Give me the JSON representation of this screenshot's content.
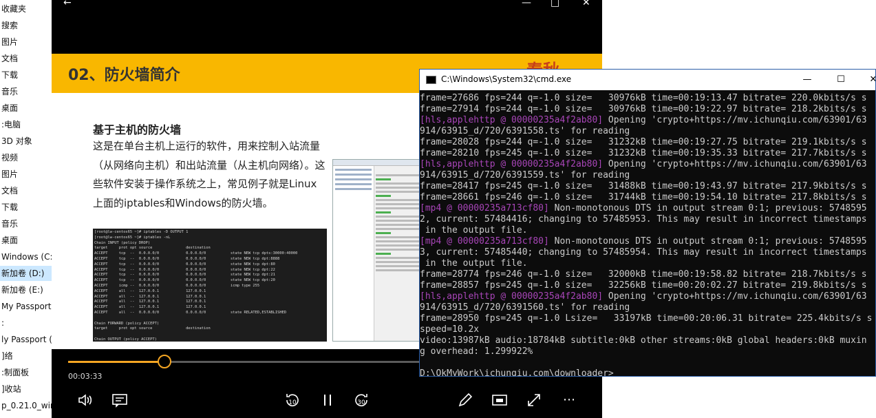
{
  "explorer": {
    "items": [
      {
        "label": "收藏夹"
      },
      {
        "label": "搜索"
      },
      {
        "label": "图片"
      },
      {
        "label": "文档"
      },
      {
        "label": "下载"
      },
      {
        "label": "音乐"
      },
      {
        "label": "桌面"
      },
      {
        "label": ":电脑"
      },
      {
        "label": "3D 对象"
      },
      {
        "label": "视频"
      },
      {
        "label": "图片"
      },
      {
        "label": "文档"
      },
      {
        "label": "下载"
      },
      {
        "label": "音乐"
      },
      {
        "label": "桌面"
      },
      {
        "label": "Windows (C:"
      },
      {
        "label": "新加卷 (D:)"
      },
      {
        "label": "新加卷 (E:)"
      },
      {
        "label": "My Passport"
      },
      {
        "label": ":"
      },
      {
        "label": "ly Passport ("
      },
      {
        "label": "]络"
      },
      {
        "label": ":制面板"
      },
      {
        "label": "]收站"
      },
      {
        "label": "p_0.21.0_win"
      }
    ],
    "selected_index": 16,
    "selected_color": "#cce8ff"
  },
  "player": {
    "slide": {
      "title": "02、防火墙简介",
      "logo_text": "春秋",
      "subtitle": "基于主机的防火墙",
      "paragraph": "这是在单台主机上运行的软件，用来控制入站流量（从网络向主机）和出站流量（从主机向网络）。这些软件安装于操作系统之上，常见例子就是Linux上面的iptables和Windows的防火墙。",
      "terminal_lines": [
        "[root@lw-centos65 ~]# iptables -D OUTPUT 1",
        "[root@lw-centos65 ~]# iptables -nL",
        "Chain INPUT (policy DROP)",
        "target     prot opt source               destination",
        "ACCEPT     tcp  --  0.0.0.0/0            0.0.0.0/0           state NEW tcp dpts:30000:40000",
        "ACCEPT     tcp  --  0.0.0.0/0            0.0.0.0/0           state NEW tcp dpt:8888",
        "ACCEPT     tcp  --  0.0.0.0/0            0.0.0.0/0           state NEW tcp dpt:80",
        "ACCEPT     tcp  --  0.0.0.0/0            0.0.0.0/0           state NEW tcp dpt:22",
        "ACCEPT     tcp  --  0.0.0.0/0            0.0.0.0/0           state NEW tcp dpt:21",
        "ACCEPT     tcp  --  0.0.0.0/0            0.0.0.0/0           state NEW tcp dpt:20",
        "ACCEPT     icmp --  0.0.0.0/0            0.0.0.0/0           icmp type 255",
        "ACCEPT     all  --  127.0.0.1            127.0.0.1",
        "ACCEPT     all  --  127.0.0.1            127.0.0.1",
        "ACCEPT     all  --  127.0.0.1            127.0.0.1",
        "ACCEPT     all  --  127.0.0.1            127.0.0.1",
        "ACCEPT     all  --  0.0.0.0/0            0.0.0.0/0           state RELATED,ESTABLISHED",
        "",
        "Chain FORWARD (policy ACCEPT)",
        "target     prot opt source               destination",
        "",
        "Chain OUTPUT (policy ACCEPT)"
      ]
    },
    "current_time": "00:03:33",
    "progress_fraction": 0.18,
    "accent_color": "#f5a623",
    "controls": {
      "back_icon": "arrow-left-icon",
      "minimize_icon": "minimize-icon",
      "maximize_icon": "maximize-icon",
      "close_icon": "close-icon",
      "rewind_label": "10",
      "forward_label": "30"
    }
  },
  "cmd": {
    "title": "C:\\Windows\\System32\\cmd.exe",
    "lines": [
      {
        "prefix": "",
        "text": "frame=27686 fps=244 q=-1.0 size=   30976kB time=00:19:13.47 bitrate= 220.0kbits/s s"
      },
      {
        "prefix": "",
        "text": "frame=27914 fps=244 q=-1.0 size=   30976kB time=00:19:22.97 bitrate= 218.2kbits/s s"
      },
      {
        "prefix": "[hls,applehttp @ 00000235a4f2ab80]",
        "text": " Opening 'crypto+https://mv.ichunqiu.com/63901/63"
      },
      {
        "prefix": "",
        "text": "914/63915_d/720/6391558.ts' for reading"
      },
      {
        "prefix": "",
        "text": "frame=28028 fps=244 q=-1.0 size=   31232kB time=00:19:27.75 bitrate= 219.1kbits/s s"
      },
      {
        "prefix": "",
        "text": "frame=28210 fps=245 q=-1.0 size=   31232kB time=00:19:35.33 bitrate= 217.7kbits/s s"
      },
      {
        "prefix": "[hls,applehttp @ 00000235a4f2ab80]",
        "text": " Opening 'crypto+https://mv.ichunqiu.com/63901/63"
      },
      {
        "prefix": "",
        "text": "914/63915_d/720/6391559.ts' for reading"
      },
      {
        "prefix": "",
        "text": "frame=28417 fps=245 q=-1.0 size=   31488kB time=00:19:43.97 bitrate= 217.9kbits/s s"
      },
      {
        "prefix": "",
        "text": "frame=28661 fps=246 q=-1.0 size=   31744kB time=00:19:54.10 bitrate= 217.8kbits/s s"
      },
      {
        "prefix": "[mp4 @ 00000235a713cf80]",
        "text": " Non-monotonous DTS in output stream 0:1; previous: 5748595"
      },
      {
        "prefix": "",
        "text": "2, current: 57484416; changing to 57485953. This may result in incorrect timestamps"
      },
      {
        "prefix": "",
        "text": " in the output file."
      },
      {
        "prefix": "[mp4 @ 00000235a713cf80]",
        "text": " Non-monotonous DTS in output stream 0:1; previous: 5748595"
      },
      {
        "prefix": "",
        "text": "3, current: 57485440; changing to 57485954. This may result in incorrect timestamps"
      },
      {
        "prefix": "",
        "text": " in the output file."
      },
      {
        "prefix": "",
        "text": "frame=28774 fps=246 q=-1.0 size=   32000kB time=00:19:58.82 bitrate= 218.7kbits/s s"
      },
      {
        "prefix": "",
        "text": "frame=28857 fps=245 q=-1.0 size=   32256kB time=00:20:02.27 bitrate= 219.8kbits/s s"
      },
      {
        "prefix": "[hls,applehttp @ 00000235a4f2ab80]",
        "text": " Opening 'crypto+https://mv.ichunqiu.com/63901/63"
      },
      {
        "prefix": "",
        "text": "914/63915_d/720/6391560.ts' for reading"
      },
      {
        "prefix": "",
        "text": "frame=28950 fps=245 q=-1.0 Lsize=   33197kB time=00:20:06.31 bitrate= 225.4kbits/s s"
      },
      {
        "prefix": "",
        "text": "speed=10.2x"
      },
      {
        "prefix": "",
        "text": "video:13987kB audio:18784kB subtitle:0kB other streams:0kB global headers:0kB muxin"
      },
      {
        "prefix": "",
        "text": "g overhead: 1.299922%"
      },
      {
        "prefix": "",
        "text": ""
      },
      {
        "prefix": "",
        "text": "D:\\OkMyWork\\ichunqiu.com\\downloader>"
      }
    ],
    "prefix_color": "#a845b8"
  }
}
